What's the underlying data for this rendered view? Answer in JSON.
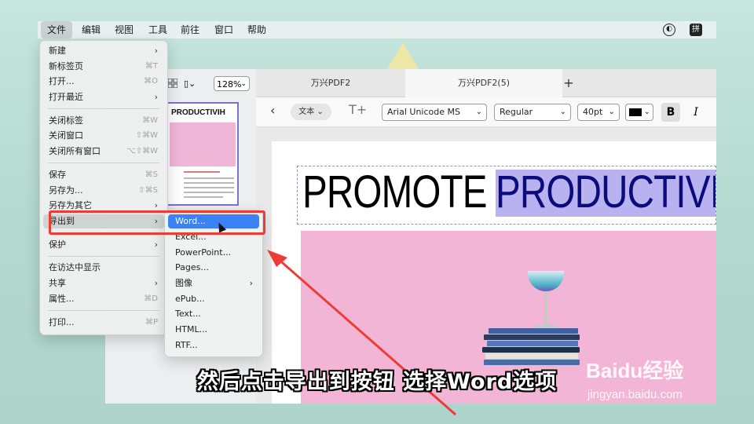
{
  "menubar": {
    "items": [
      "文件",
      "编辑",
      "视图",
      "工具",
      "前往",
      "窗口",
      "帮助"
    ],
    "right_icon_2": "拼"
  },
  "left_panel": {
    "zoom": "128%",
    "thumbnail_title": "PRODUCTIVIH"
  },
  "tabs": [
    "万兴PDF2",
    "万兴PDF2(5)"
  ],
  "format_toolbar": {
    "mode_chip": "文本",
    "font_family": "Arial Unicode MS",
    "font_style": "Regular",
    "font_size": "40pt",
    "bold_label": "B",
    "italic_label": "I",
    "color": "#000000"
  },
  "document": {
    "headline_part1": "PROMOTE",
    "headline_part2": "PRODUCTIVI"
  },
  "file_menu": {
    "items": [
      {
        "label": "新建",
        "shortcut": "",
        "submenu": true
      },
      {
        "label": "新标签页",
        "shortcut": "⌘T",
        "submenu": false
      },
      {
        "label": "打开...",
        "shortcut": "⌘O",
        "submenu": false
      },
      {
        "label": "打开最近",
        "shortcut": "",
        "submenu": true
      },
      {
        "label": "关闭标签",
        "shortcut": "⌘W",
        "submenu": false
      },
      {
        "label": "关闭窗口",
        "shortcut": "⇧⌘W",
        "submenu": false
      },
      {
        "label": "关闭所有窗口",
        "shortcut": "⌥⇧⌘W",
        "submenu": false
      },
      {
        "label": "保存",
        "shortcut": "⌘S",
        "submenu": false
      },
      {
        "label": "另存为...",
        "shortcut": "⇧⌘S",
        "submenu": false
      },
      {
        "label": "另存为其它",
        "shortcut": "",
        "submenu": true
      },
      {
        "label": "导出到",
        "shortcut": "",
        "submenu": true
      },
      {
        "label": "保护",
        "shortcut": "",
        "submenu": true
      },
      {
        "label": "在访达中显示",
        "shortcut": "",
        "submenu": false
      },
      {
        "label": "共享",
        "shortcut": "",
        "submenu": true
      },
      {
        "label": "属性...",
        "shortcut": "⌘D",
        "submenu": false
      },
      {
        "label": "打印...",
        "shortcut": "⌘P",
        "submenu": false
      }
    ]
  },
  "export_submenu": {
    "items": [
      {
        "label": "Word...",
        "submenu": false
      },
      {
        "label": "Excel...",
        "submenu": false
      },
      {
        "label": "PowerPoint...",
        "submenu": false
      },
      {
        "label": "Pages...",
        "submenu": false
      },
      {
        "label": "图像",
        "submenu": true
      },
      {
        "label": "ePub...",
        "submenu": false
      },
      {
        "label": "Text...",
        "submenu": false
      },
      {
        "label": "HTML...",
        "submenu": false
      },
      {
        "label": "RTF...",
        "submenu": false
      }
    ]
  },
  "caption": "然后点击导出到按钮 选择Word选项",
  "watermark": {
    "brand": "Baidu经验",
    "url": "jingyan.baidu.com"
  },
  "colors": {
    "annotation_red": "#ef3b36",
    "selection_blue": "#3a82f6",
    "highlight_purple": "#b8b2f1",
    "photo_pink": "#f3b5d5"
  }
}
